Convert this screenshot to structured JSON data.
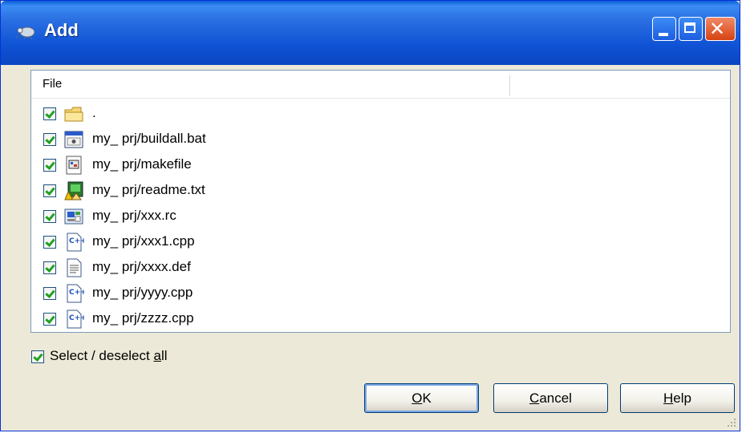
{
  "window": {
    "title": "Add",
    "controls": {
      "minimize": "minimize",
      "maximize": "maximize",
      "close": "✕"
    }
  },
  "list": {
    "column_header": "File",
    "rows": [
      {
        "name": ".",
        "icon": "folder-icon",
        "checked": true
      },
      {
        "name": "my_ prj/buildall.bat",
        "icon": "batch-file-icon",
        "checked": true
      },
      {
        "name": "my_ prj/makefile",
        "icon": "makefile-icon",
        "checked": true
      },
      {
        "name": "my_ prj/readme.txt",
        "icon": "text-document-icon",
        "checked": true
      },
      {
        "name": "my_ prj/xxx.rc",
        "icon": "resource-file-icon",
        "checked": true
      },
      {
        "name": "my_ prj/xxx1.cpp",
        "icon": "cpp-file-icon",
        "checked": true
      },
      {
        "name": "my_ prj/xxxx.def",
        "icon": "generic-file-icon",
        "checked": true
      },
      {
        "name": "my_ prj/yyyy.cpp",
        "icon": "cpp-file-icon",
        "checked": true
      },
      {
        "name": "my_ prj/zzzz.cpp",
        "icon": "cpp-file-icon",
        "checked": true
      }
    ]
  },
  "select_all": {
    "label": "Select / deselect all",
    "checked": true
  },
  "buttons": {
    "ok": "OK",
    "cancel": "Cancel",
    "help": "Help"
  }
}
